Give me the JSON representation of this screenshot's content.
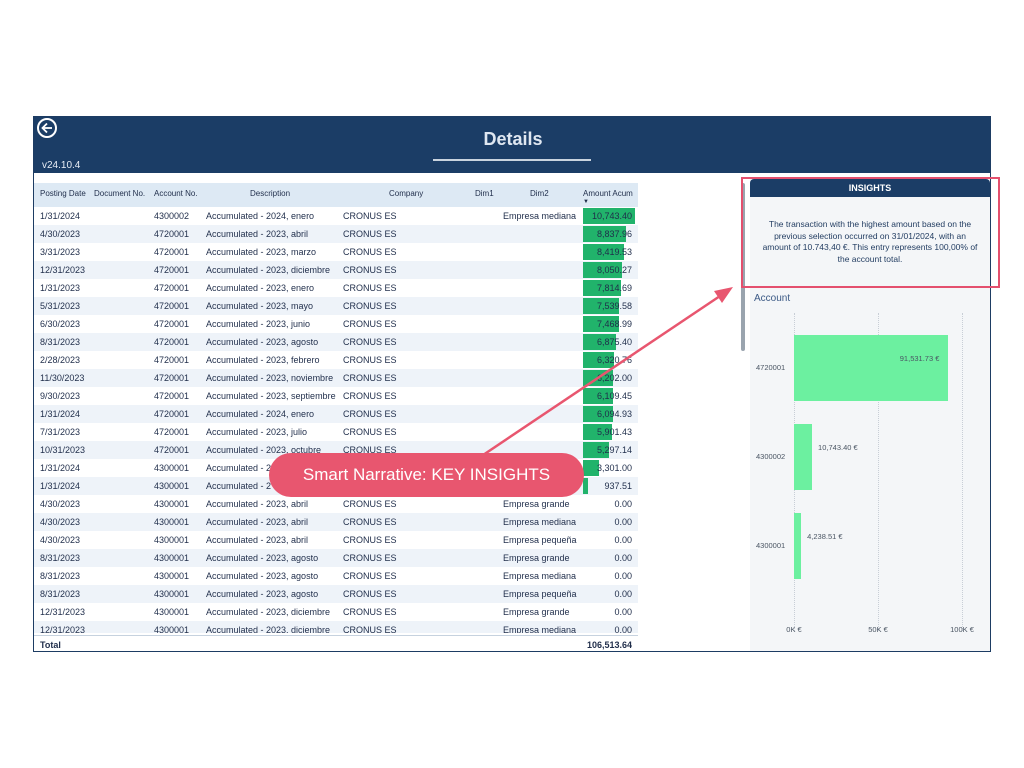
{
  "header": {
    "title": "Details",
    "version": "v24.10.4"
  },
  "table": {
    "columns": [
      "Posting Date",
      "Document No.",
      "Account No.",
      "Description",
      "Company",
      "Dim1",
      "Dim2",
      "Amount Acum"
    ],
    "amount_max": 10743.4,
    "rows": [
      {
        "date": "1/31/2024",
        "account": "4300002",
        "description": "Accumulated - 2024, enero",
        "company": "CRONUS ES",
        "dim2": "Empresa mediana",
        "amount": "10,743.40",
        "value": 10743.4
      },
      {
        "date": "4/30/2023",
        "account": "4720001",
        "description": "Accumulated - 2023, abril",
        "company": "CRONUS ES",
        "dim2": "",
        "amount": "8,837.96",
        "value": 8837.96
      },
      {
        "date": "3/31/2023",
        "account": "4720001",
        "description": "Accumulated - 2023, marzo",
        "company": "CRONUS ES",
        "dim2": "",
        "amount": "8,419.53",
        "value": 8419.53
      },
      {
        "date": "12/31/2023",
        "account": "4720001",
        "description": "Accumulated - 2023, diciembre",
        "company": "CRONUS ES",
        "dim2": "",
        "amount": "8,050.27",
        "value": 8050.27
      },
      {
        "date": "1/31/2023",
        "account": "4720001",
        "description": "Accumulated - 2023, enero",
        "company": "CRONUS ES",
        "dim2": "",
        "amount": "7,814.69",
        "value": 7814.69
      },
      {
        "date": "5/31/2023",
        "account": "4720001",
        "description": "Accumulated - 2023, mayo",
        "company": "CRONUS ES",
        "dim2": "",
        "amount": "7,539.58",
        "value": 7539.58
      },
      {
        "date": "6/30/2023",
        "account": "4720001",
        "description": "Accumulated - 2023, junio",
        "company": "CRONUS ES",
        "dim2": "",
        "amount": "7,468.99",
        "value": 7468.99
      },
      {
        "date": "8/31/2023",
        "account": "4720001",
        "description": "Accumulated - 2023, agosto",
        "company": "CRONUS ES",
        "dim2": "",
        "amount": "6,875.40",
        "value": 6875.4
      },
      {
        "date": "2/28/2023",
        "account": "4720001",
        "description": "Accumulated - 2023, febrero",
        "company": "CRONUS ES",
        "dim2": "",
        "amount": "6,320.76",
        "value": 6320.76
      },
      {
        "date": "11/30/2023",
        "account": "4720001",
        "description": "Accumulated - 2023, noviembre",
        "company": "CRONUS ES",
        "dim2": "",
        "amount": "6,202.00",
        "value": 6202.0
      },
      {
        "date": "9/30/2023",
        "account": "4720001",
        "description": "Accumulated - 2023, septiembre",
        "company": "CRONUS ES",
        "dim2": "",
        "amount": "6,109.45",
        "value": 6109.45
      },
      {
        "date": "1/31/2024",
        "account": "4720001",
        "description": "Accumulated - 2024, enero",
        "company": "CRONUS ES",
        "dim2": "",
        "amount": "6,094.93",
        "value": 6094.93
      },
      {
        "date": "7/31/2023",
        "account": "4720001",
        "description": "Accumulated - 2023, julio",
        "company": "CRONUS ES",
        "dim2": "",
        "amount": "5,901.43",
        "value": 5901.43
      },
      {
        "date": "10/31/2023",
        "account": "4720001",
        "description": "Accumulated - 2023, octubre",
        "company": "CRONUS ES",
        "dim2": "",
        "amount": "5,297.14",
        "value": 5297.14
      },
      {
        "date": "1/31/2024",
        "account": "4300001",
        "description": "Accumulated - 2",
        "company": "",
        "dim2": "",
        "amount": "3,301.00",
        "value": 3301.0
      },
      {
        "date": "1/31/2024",
        "account": "4300001",
        "description": "Accumulated - 2",
        "company": "",
        "dim2": "",
        "amount": "937.51",
        "value": 937.51
      },
      {
        "date": "4/30/2023",
        "account": "4300001",
        "description": "Accumulated - 2023, abril",
        "company": "CRONUS ES",
        "dim2": "Empresa grande",
        "amount": "0.00",
        "value": 0
      },
      {
        "date": "4/30/2023",
        "account": "4300001",
        "description": "Accumulated - 2023, abril",
        "company": "CRONUS ES",
        "dim2": "Empresa mediana",
        "amount": "0.00",
        "value": 0
      },
      {
        "date": "4/30/2023",
        "account": "4300001",
        "description": "Accumulated - 2023, abril",
        "company": "CRONUS ES",
        "dim2": "Empresa pequeña",
        "amount": "0.00",
        "value": 0
      },
      {
        "date": "8/31/2023",
        "account": "4300001",
        "description": "Accumulated - 2023, agosto",
        "company": "CRONUS ES",
        "dim2": "Empresa grande",
        "amount": "0.00",
        "value": 0
      },
      {
        "date": "8/31/2023",
        "account": "4300001",
        "description": "Accumulated - 2023, agosto",
        "company": "CRONUS ES",
        "dim2": "Empresa mediana",
        "amount": "0.00",
        "value": 0
      },
      {
        "date": "8/31/2023",
        "account": "4300001",
        "description": "Accumulated - 2023, agosto",
        "company": "CRONUS ES",
        "dim2": "Empresa pequeña",
        "amount": "0.00",
        "value": 0
      },
      {
        "date": "12/31/2023",
        "account": "4300001",
        "description": "Accumulated - 2023, diciembre",
        "company": "CRONUS ES",
        "dim2": "Empresa grande",
        "amount": "0.00",
        "value": 0
      },
      {
        "date": "12/31/2023",
        "account": "4300001",
        "description": "Accumulated - 2023, diciembre",
        "company": "CRONUS ES",
        "dim2": "Empresa mediana",
        "amount": "0.00",
        "value": 0
      }
    ],
    "total_label": "Total",
    "total_value": "106,513.64"
  },
  "insights": {
    "title": "INSIGHTS",
    "text": "The transaction with the highest amount based on the previous selection occurred on 31/01/2024, with an amount of 10.743,40 €. This entry represents 100,00% of the account total."
  },
  "chart_data": {
    "type": "bar",
    "orientation": "horizontal",
    "title": "Account",
    "categories": [
      "4720001",
      "4300002",
      "4300001"
    ],
    "values": [
      91531.73,
      10743.4,
      4238.51
    ],
    "value_labels": [
      "91,531.73 €",
      "10,743.40 €",
      "4,238.51 €"
    ],
    "xlim": [
      0,
      100000
    ],
    "x_ticks": [
      0,
      50000,
      100000
    ],
    "x_tick_labels": [
      "0K €",
      "50K €",
      "100K €"
    ],
    "bar_color": "#6cf0a0"
  },
  "annotation": {
    "callout_text": "Smart Narrative: KEY INSIGHTS",
    "color": "#e8566f"
  }
}
